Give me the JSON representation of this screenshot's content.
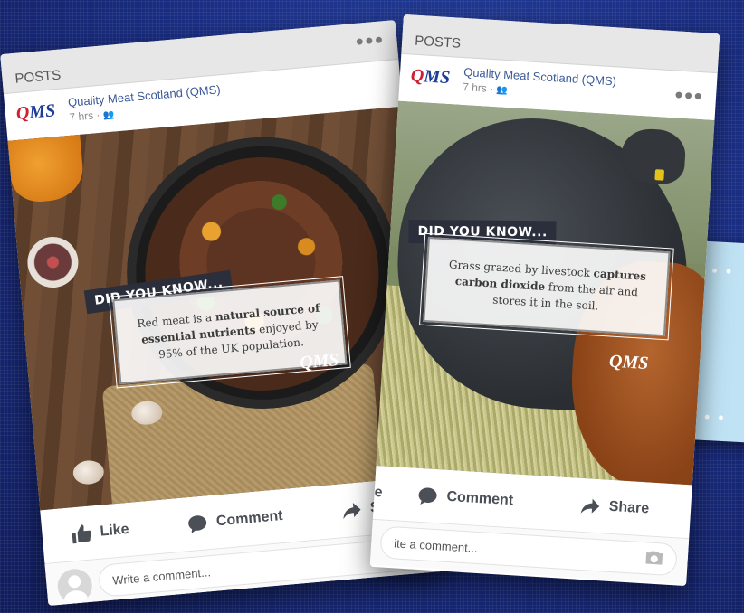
{
  "posts_label": "POSTS",
  "page_name": "Quality Meat Scotland (QMS)",
  "post_time": "7 hrs ·",
  "logo": {
    "q": "Q",
    "ms": "MS"
  },
  "image_logo": "QMS",
  "did_you_know": "DID YOU KNOW...",
  "left_post": {
    "fact": {
      "part1": "Red meat is a ",
      "bold": "natural source of essential nutrients",
      "part2": " enjoyed by 95% of the UK population."
    }
  },
  "right_post": {
    "fact": {
      "part1": "Grass grazed by livestock ",
      "bold": "captures carbon dioxide",
      "part2": " from the air and stores it in the soil."
    }
  },
  "actions": {
    "like": "Like",
    "comment": "Comment",
    "share": "Share",
    "clipped_like": "e"
  },
  "comment_placeholder": "Write a comment...",
  "comment_placeholder_clipped": "ite a comment...",
  "colors": {
    "page_name": "#3b5998",
    "background": "#1b2f86",
    "did_you_know_bg": "#2b2f3c"
  }
}
